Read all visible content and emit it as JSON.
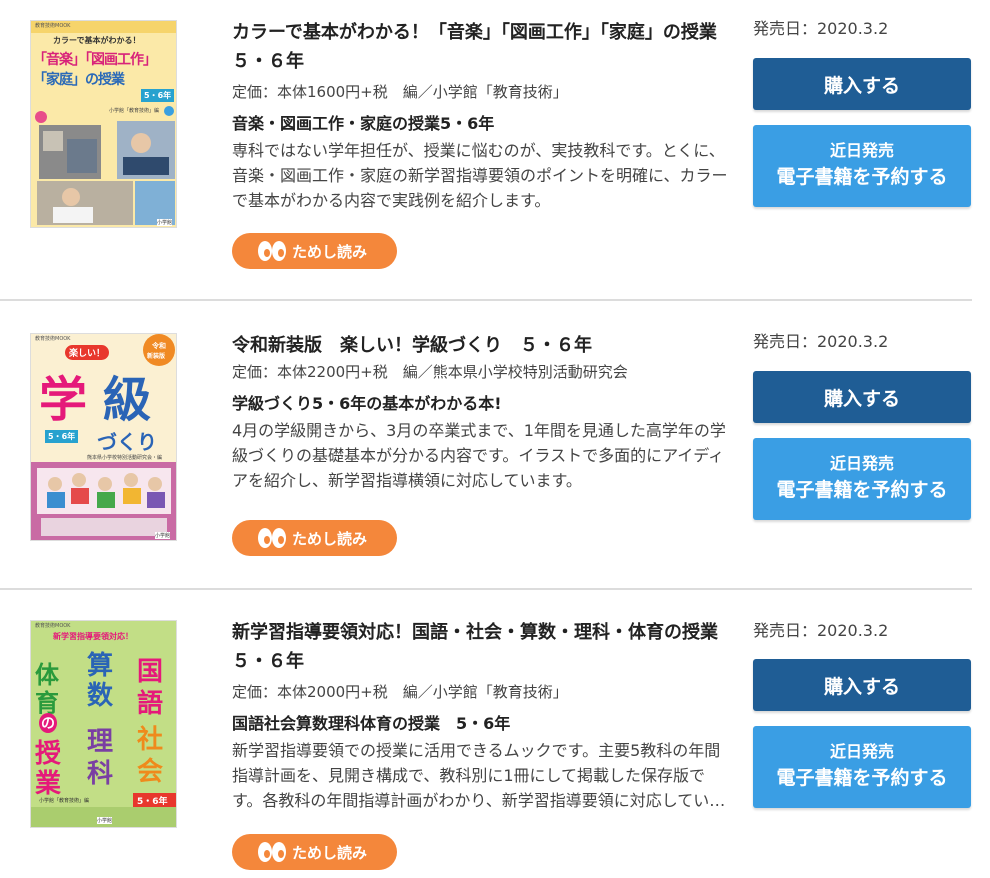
{
  "books": [
    {
      "title": "カラーで基本がわかる！「音楽」「図画工作」「家庭」の授業５・６年",
      "price": "定価：本体1600円+税　編／小学館「教育技術」",
      "subtitle": "音楽・図画工作・家庭の授業5・6年",
      "description": "専科ではない学年担任が、授業に悩むのが、実技教科です。とくに、音楽・図画工作・家庭の新学習指導要領のポイントを明確に、カラーで基本がわかる内容で実践例を紹介します。",
      "trial_label": "ためし読み",
      "date": "発売日：2020.3.2",
      "buy_label": "購入する",
      "ebook_small": "近日発売",
      "ebook_big": "電子書籍を予約する",
      "cover": {
        "series": "教育技術MOOK",
        "tagline": "カラーで基本がわかる！",
        "line1": "「音楽」「図画工作」",
        "line2": "「家庭」の授業",
        "grade": "5・6年",
        "editor": "小学館「教育技術」編",
        "publisher": "小学館"
      }
    },
    {
      "title": "令和新装版　楽しい！学級づくり　５・６年",
      "price": "定価：本体2200円+税　編／熊本県小学校特別活動研究会",
      "subtitle": "学級づくり5・6年の基本がわかる本!",
      "description": "4月の学級開きから、3月の卒業式まで、1年間を見通した高学年の学級づくりの基礎基本が分かる内容です。イラストで多面的にアイディアを紹介し、新学習指導横領に対応しています。",
      "trial_label": "ためし読み",
      "date": "発売日：2020.3.2",
      "buy_label": "購入する",
      "ebook_small": "近日発売",
      "ebook_big": "電子書籍を予約する",
      "cover": {
        "series": "教育技術MOOK",
        "badge_top": "楽しい！",
        "badge_reiwa": "令和",
        "badge_new": "新装版",
        "main1": "学",
        "main2": "級",
        "grade": "5・6年",
        "sub": "づくり",
        "editor": "熊本県小学校特別活動研究会・編",
        "publisher": "小学館"
      }
    },
    {
      "title": "新学習指導要領対応！国語・社会・算数・理科・体育の授業５・６年",
      "price": "定価：本体2000円+税　編／小学館「教育技術」",
      "subtitle": "国語社会算数理科体育の授業　5・6年",
      "description": "新学習指導要領での授業に活用できるムックです。主要5教科の年間指導計画を、見開き構成で、教科別に1冊にして掲載した保存版です。各教科の年間指導計画がわかり、新学習指導要領に対応しています。",
      "trial_label": "ためし読み",
      "date": "発売日：2020.3.2",
      "buy_label": "購入する",
      "ebook_small": "近日発売",
      "ebook_big": "電子書籍を予約する",
      "cover": {
        "series": "教育技術MOOK",
        "tagline": "新学習指導要領対応！",
        "c1a": "体",
        "c1b": "育",
        "c2a": "算",
        "c2b": "数",
        "c3a": "国",
        "c3b": "語",
        "no": "の",
        "c4a": "授",
        "c4b": "業",
        "c5a": "理",
        "c5b": "科",
        "c6a": "社",
        "c6b": "会",
        "grade": "5・6年",
        "editor": "小学館「教育技術」編",
        "publisher": "小学館"
      }
    }
  ],
  "colors": {
    "buy": "#1f5d95",
    "ebook": "#3a9ee4",
    "trial": "#f4873b",
    "divider": "#dcdcdc"
  }
}
